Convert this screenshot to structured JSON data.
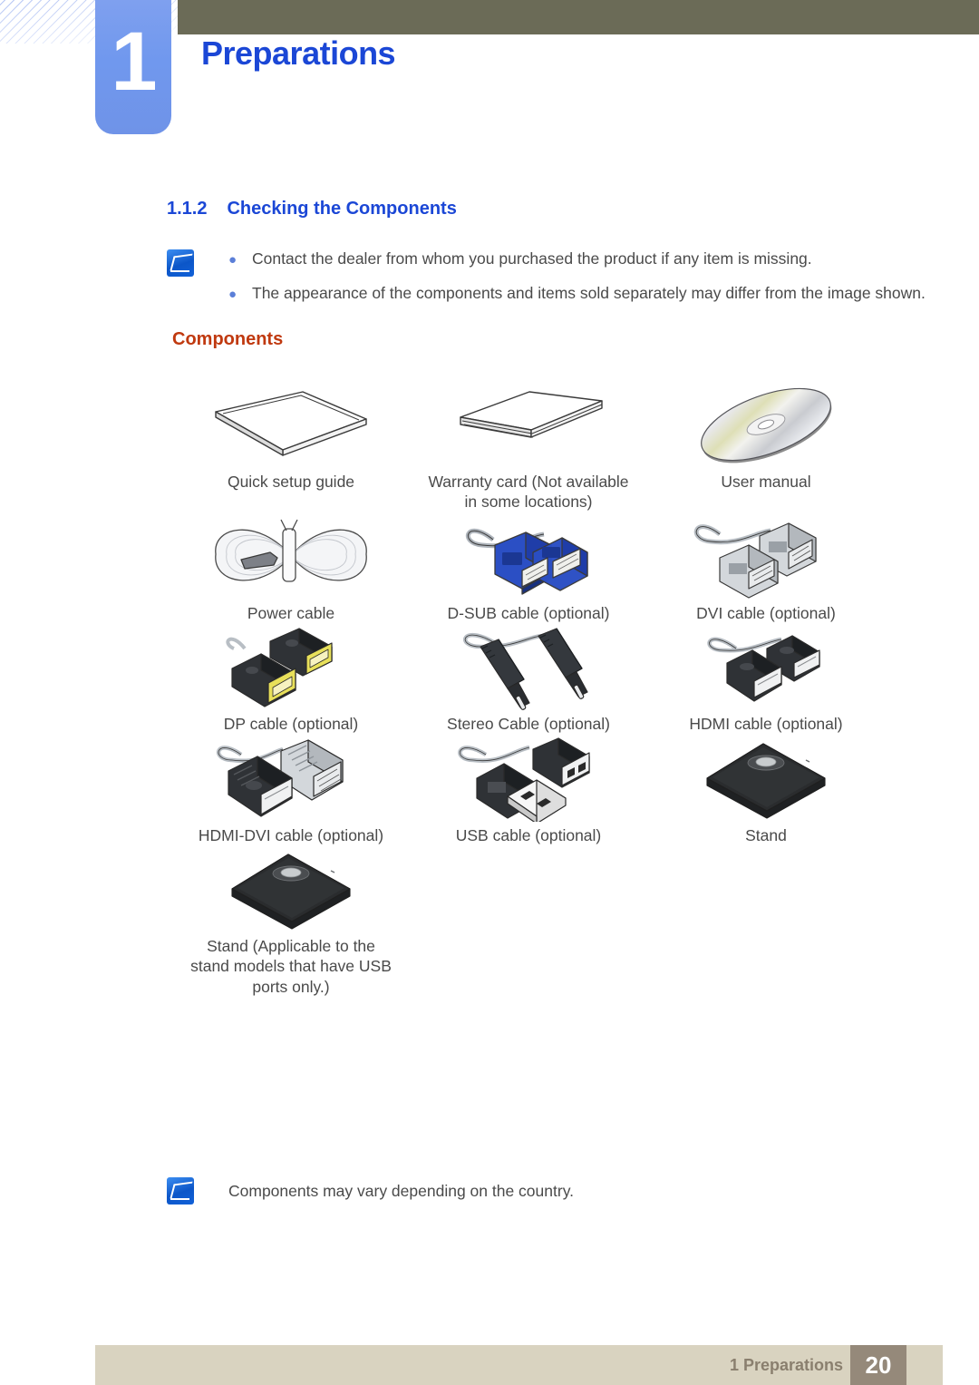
{
  "header": {
    "chapter_number": "1",
    "chapter_title": "Preparations",
    "bar_color": "#6b6b57",
    "badge_color": "#7098ee",
    "title_color": "#1b47d6"
  },
  "section": {
    "number": "1.1.2",
    "title": "Checking the Components"
  },
  "note_top": {
    "icon": "note-pen-icon",
    "bullets": [
      "Contact the dealer from whom you purchased the product if any item is missing.",
      "The appearance of the components and items sold separately may differ from the image shown."
    ]
  },
  "components_heading": {
    "label": "Components",
    "color": "#c0390f"
  },
  "components": [
    [
      {
        "name": "quick-setup-guide",
        "icon": "booklet-icon",
        "caption": "Quick setup guide"
      },
      {
        "name": "warranty-card",
        "icon": "card-stack-icon",
        "caption": "Warranty card\n(Not available in some locations)"
      },
      {
        "name": "user-manual",
        "icon": "cd-disc-icon",
        "caption": "User manual"
      }
    ],
    [
      {
        "name": "power-cable",
        "icon": "coiled-power-cable-icon",
        "caption": "Power cable"
      },
      {
        "name": "dsub-cable",
        "icon": "dsub-connector-icon",
        "caption": "D-SUB cable (optional)"
      },
      {
        "name": "dvi-cable",
        "icon": "dvi-connector-icon",
        "caption": "DVI cable (optional)"
      }
    ],
    [
      {
        "name": "dp-cable",
        "icon": "displayport-connector-icon",
        "caption": "DP cable (optional)"
      },
      {
        "name": "stereo-cable",
        "icon": "stereo-jack-icon",
        "caption": "Stereo Cable (optional)"
      },
      {
        "name": "hdmi-cable",
        "icon": "hdmi-connector-icon",
        "caption": "HDMI cable (optional)"
      }
    ],
    [
      {
        "name": "hdmi-dvi-cable",
        "icon": "hdmi-dvi-connector-icon",
        "caption": "HDMI-DVI cable (optional)"
      },
      {
        "name": "usb-cable",
        "icon": "usb-connector-icon",
        "caption": "USB cable (optional)"
      },
      {
        "name": "stand",
        "icon": "monitor-stand-base-icon",
        "caption": "Stand"
      }
    ],
    [
      {
        "name": "stand-usb",
        "icon": "monitor-stand-base-icon",
        "caption": "Stand\n(Applicable to the stand models that have USB ports only.)"
      }
    ]
  ],
  "note_bottom": {
    "icon": "note-pen-icon",
    "text": "Components may vary depending on the country."
  },
  "footer": {
    "label": "1 Preparations",
    "page_number": "20",
    "bar_color": "#d9d3c0",
    "page_box_color": "#95897a"
  }
}
